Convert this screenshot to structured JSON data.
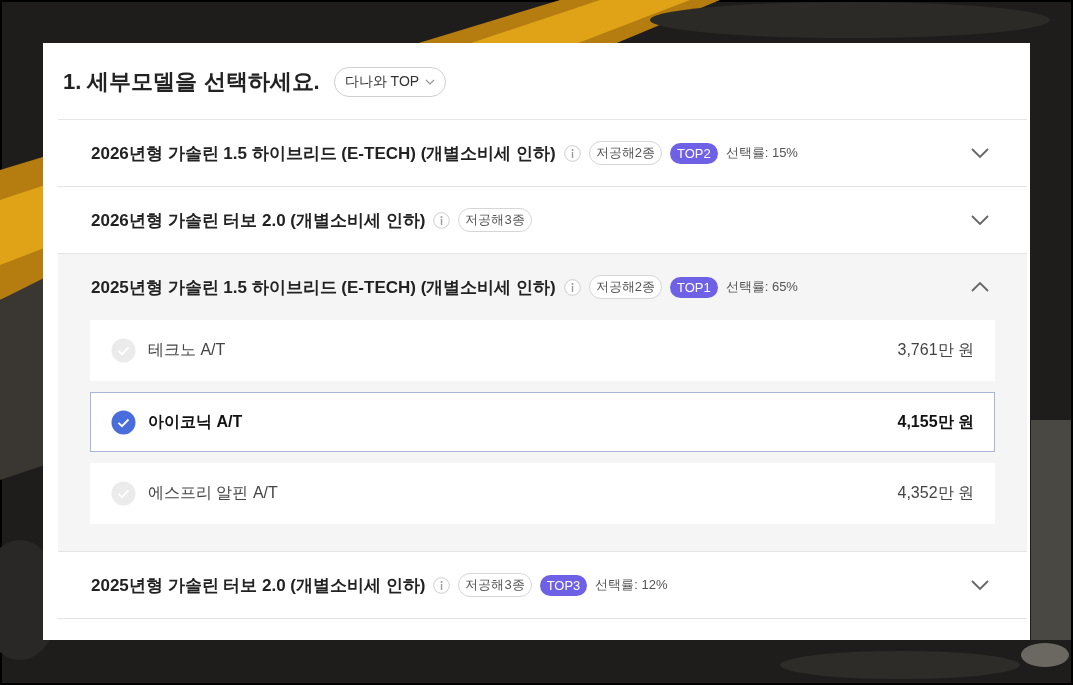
{
  "title": "1. 세부모델을 선택하세요.",
  "filter": {
    "label": "다나와 TOP"
  },
  "models": [
    {
      "name": "2026년형 가솔린 1.5 하이브리드 (E-TECH) (개별소비세 인하)",
      "emission": "저공해2종",
      "rank": "TOP2",
      "rate": "선택률: 15%",
      "expanded": false
    },
    {
      "name": "2026년형 가솔린 터보 2.0 (개별소비세 인하)",
      "emission": "저공해3종",
      "expanded": false
    },
    {
      "name": "2025년형 가솔린 1.5 하이브리드 (E-TECH) (개별소비세 인하)",
      "emission": "저공해2종",
      "rank": "TOP1",
      "rate": "선택률: 65%",
      "expanded": true,
      "trims": [
        {
          "name": "테크노 A/T",
          "price": "3,761만 원",
          "selected": false
        },
        {
          "name": "아이코닉 A/T",
          "price": "4,155만 원",
          "selected": true
        },
        {
          "name": "에스프리 알핀 A/T",
          "price": "4,352만 원",
          "selected": false
        }
      ]
    },
    {
      "name": "2025년형 가솔린 터보 2.0 (개별소비세 인하)",
      "emission": "저공해3종",
      "rank": "TOP3",
      "rate": "선택률: 12%",
      "expanded": false
    }
  ]
}
